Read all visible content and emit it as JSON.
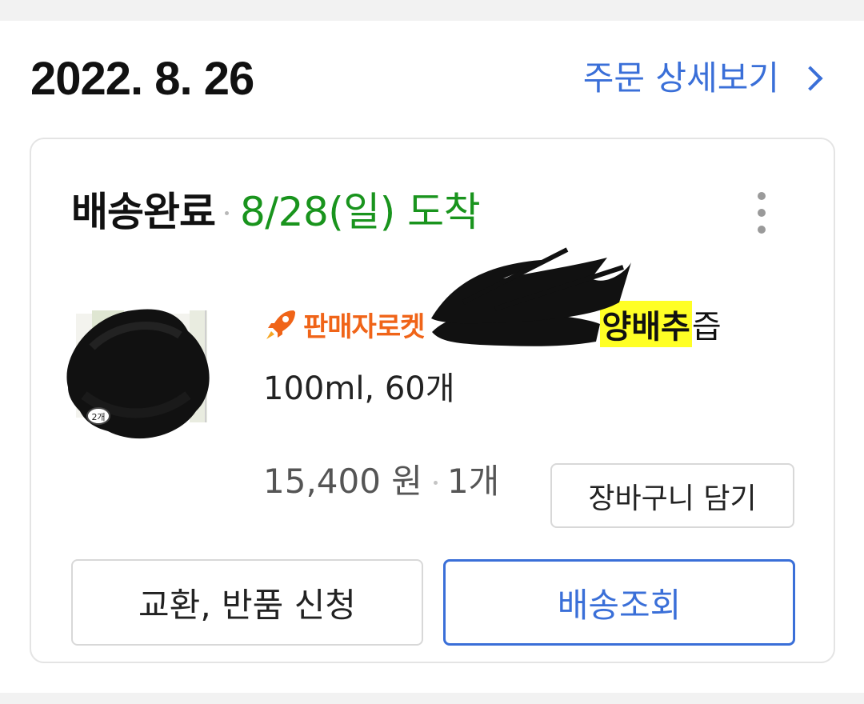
{
  "order": {
    "date": "2022. 8. 26",
    "detail_link_label": "주문 상세보기"
  },
  "card": {
    "status": "배송완료",
    "arrival": "8/28(일) 도착",
    "product": {
      "badge": "판매자로켓",
      "name_highlight": "양배추",
      "name_suffix": "즙",
      "thumbnail_badge": "2개",
      "option": "100ml, 60개",
      "price": "15,400 원",
      "quantity": "1개"
    },
    "buttons": {
      "add_to_cart": "장바구니 담기",
      "exchange_return": "교환, 반품 신청",
      "track_delivery": "배송조회"
    }
  },
  "colors": {
    "link_blue": "#3a6fd8",
    "arrival_green": "#19941d",
    "rocket_orange": "#f06418",
    "highlight_yellow": "#ffff25"
  },
  "icons": [
    "chevron-right-icon",
    "more-vertical-icon",
    "rocket-icon"
  ]
}
